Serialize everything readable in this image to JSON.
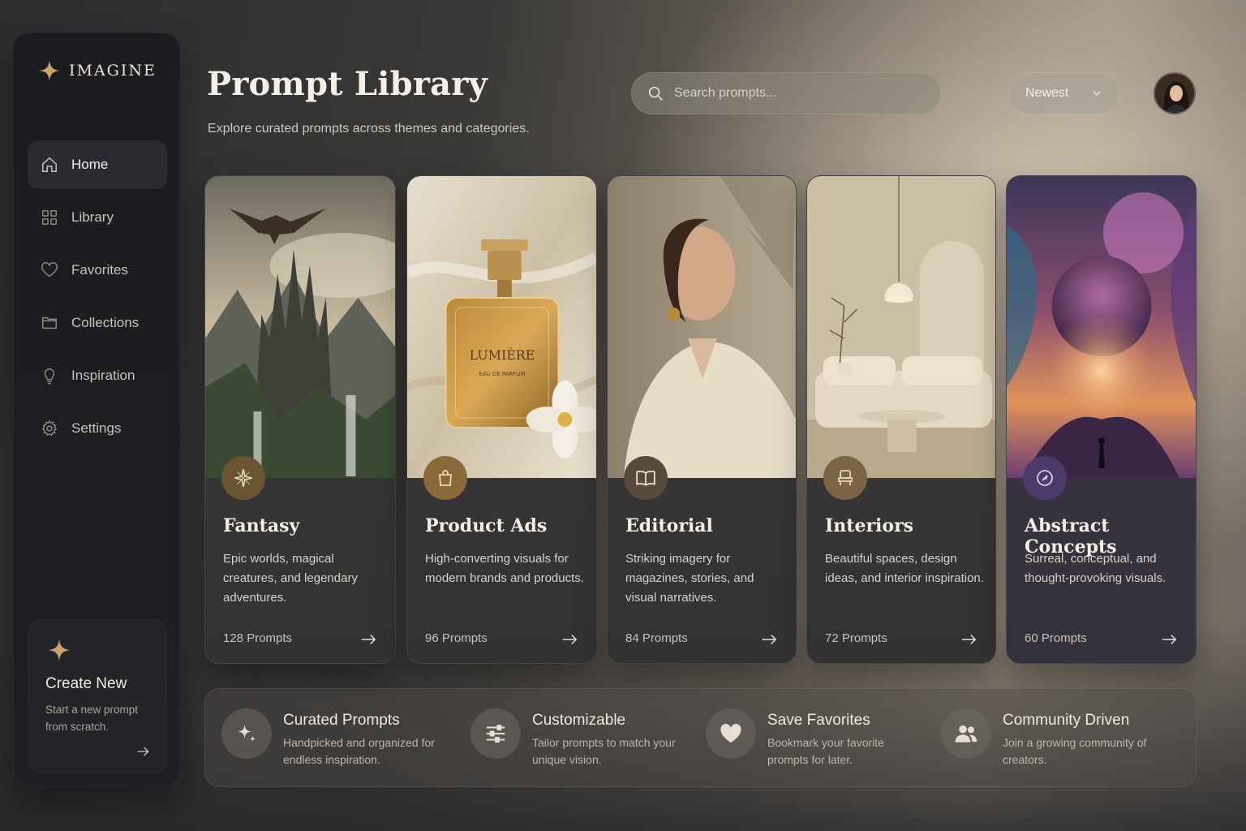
{
  "brand": {
    "name": "IMAGINE"
  },
  "sidebar": {
    "items": [
      {
        "label": "Home",
        "icon": "home-icon",
        "active": true
      },
      {
        "label": "Library",
        "icon": "grid-icon",
        "active": false
      },
      {
        "label": "Favorites",
        "icon": "heart-icon",
        "active": false
      },
      {
        "label": "Collections",
        "icon": "folder-icon",
        "active": false
      },
      {
        "label": "Inspiration",
        "icon": "lightbulb-icon",
        "active": false
      },
      {
        "label": "Settings",
        "icon": "gear-icon",
        "active": false
      }
    ],
    "create": {
      "title": "Create New",
      "description": "Start a new prompt from scratch."
    }
  },
  "header": {
    "title": "Prompt Library",
    "subtitle": "Explore curated prompts across themes and categories.",
    "search_placeholder": "Search prompts...",
    "sort_label": "Newest"
  },
  "cards": [
    {
      "title": "Fantasy",
      "description": "Epic worlds, magical creatures, and legendary adventures.",
      "count": "128 Prompts",
      "icon": "compass-star-icon",
      "badge_color": "#6b5433"
    },
    {
      "title": "Product Ads",
      "description": "High-converting visuals for modern brands and products.",
      "count": "96 Prompts",
      "icon": "shopping-bag-icon",
      "badge_color": "#8a6a3b",
      "bottle_label": "LUMIÈRE",
      "bottle_sub": "EAU DE PARFUM"
    },
    {
      "title": "Editorial",
      "description": "Striking imagery for magazines, stories, and visual narratives.",
      "count": "84 Prompts",
      "icon": "book-icon",
      "badge_color": "#5a4a3b"
    },
    {
      "title": "Interiors",
      "description": "Beautiful spaces, design ideas, and interior inspiration.",
      "count": "72 Prompts",
      "icon": "chair-icon",
      "badge_color": "#7d6446"
    },
    {
      "title": "Abstract Concepts",
      "description": "Surreal, conceptual, and thought-provoking visuals.",
      "count": "60 Prompts",
      "icon": "compass-icon",
      "badge_color": "#4d3a6b"
    }
  ],
  "features": [
    {
      "title": "Curated Prompts",
      "description": "Handpicked and organized for endless inspiration.",
      "icon": "sparkles-icon"
    },
    {
      "title": "Customizable",
      "description": "Tailor prompts to match your unique vision.",
      "icon": "sliders-icon"
    },
    {
      "title": "Save Favorites",
      "description": "Bookmark your favorite prompts for later.",
      "icon": "heart-filled-icon"
    },
    {
      "title": "Community Driven",
      "description": "Join a growing community of creators.",
      "icon": "users-icon"
    }
  ],
  "colors": {
    "accent_gold": "#c9a56a",
    "sidebar_bg": "#1c1d21",
    "card_bg": "#363534"
  }
}
